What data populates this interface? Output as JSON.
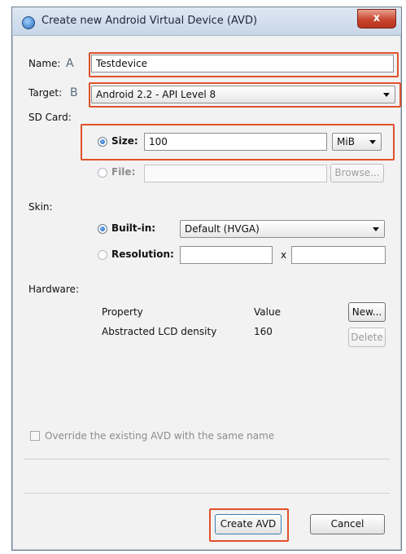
{
  "window": {
    "title": "Create new Android Virtual Device (AVD)",
    "close_glyph": "x"
  },
  "name": {
    "label": "Name:",
    "marker": "A",
    "value": "Testdevice"
  },
  "target": {
    "label": "Target:",
    "marker": "B",
    "value": "Android 2.2 - API Level 8"
  },
  "sdcard": {
    "label": "SD Card:",
    "size_label": "Size:",
    "size_value": "100",
    "unit": "MiB",
    "file_label": "File:",
    "file_value": "",
    "browse_label": "Browse..."
  },
  "skin": {
    "label": "Skin:",
    "builtin_label": "Built-in:",
    "builtin_value": "Default (HVGA)",
    "resolution_label": "Resolution:",
    "x_label": "x"
  },
  "hardware": {
    "label": "Hardware:",
    "columns": [
      "Property",
      "Value"
    ],
    "rows": [
      {
        "property": "Abstracted LCD density",
        "value": "160"
      }
    ],
    "new_label": "New...",
    "delete_label": "Delete"
  },
  "override": {
    "label": "Override the existing AVD with the same name",
    "checked": false
  },
  "buttons": {
    "create_label": "Create AVD",
    "cancel_label": "Cancel"
  },
  "colors": {
    "highlight": "#e0512b",
    "titlebar": "#c7d6e8",
    "close": "#c9452f"
  }
}
